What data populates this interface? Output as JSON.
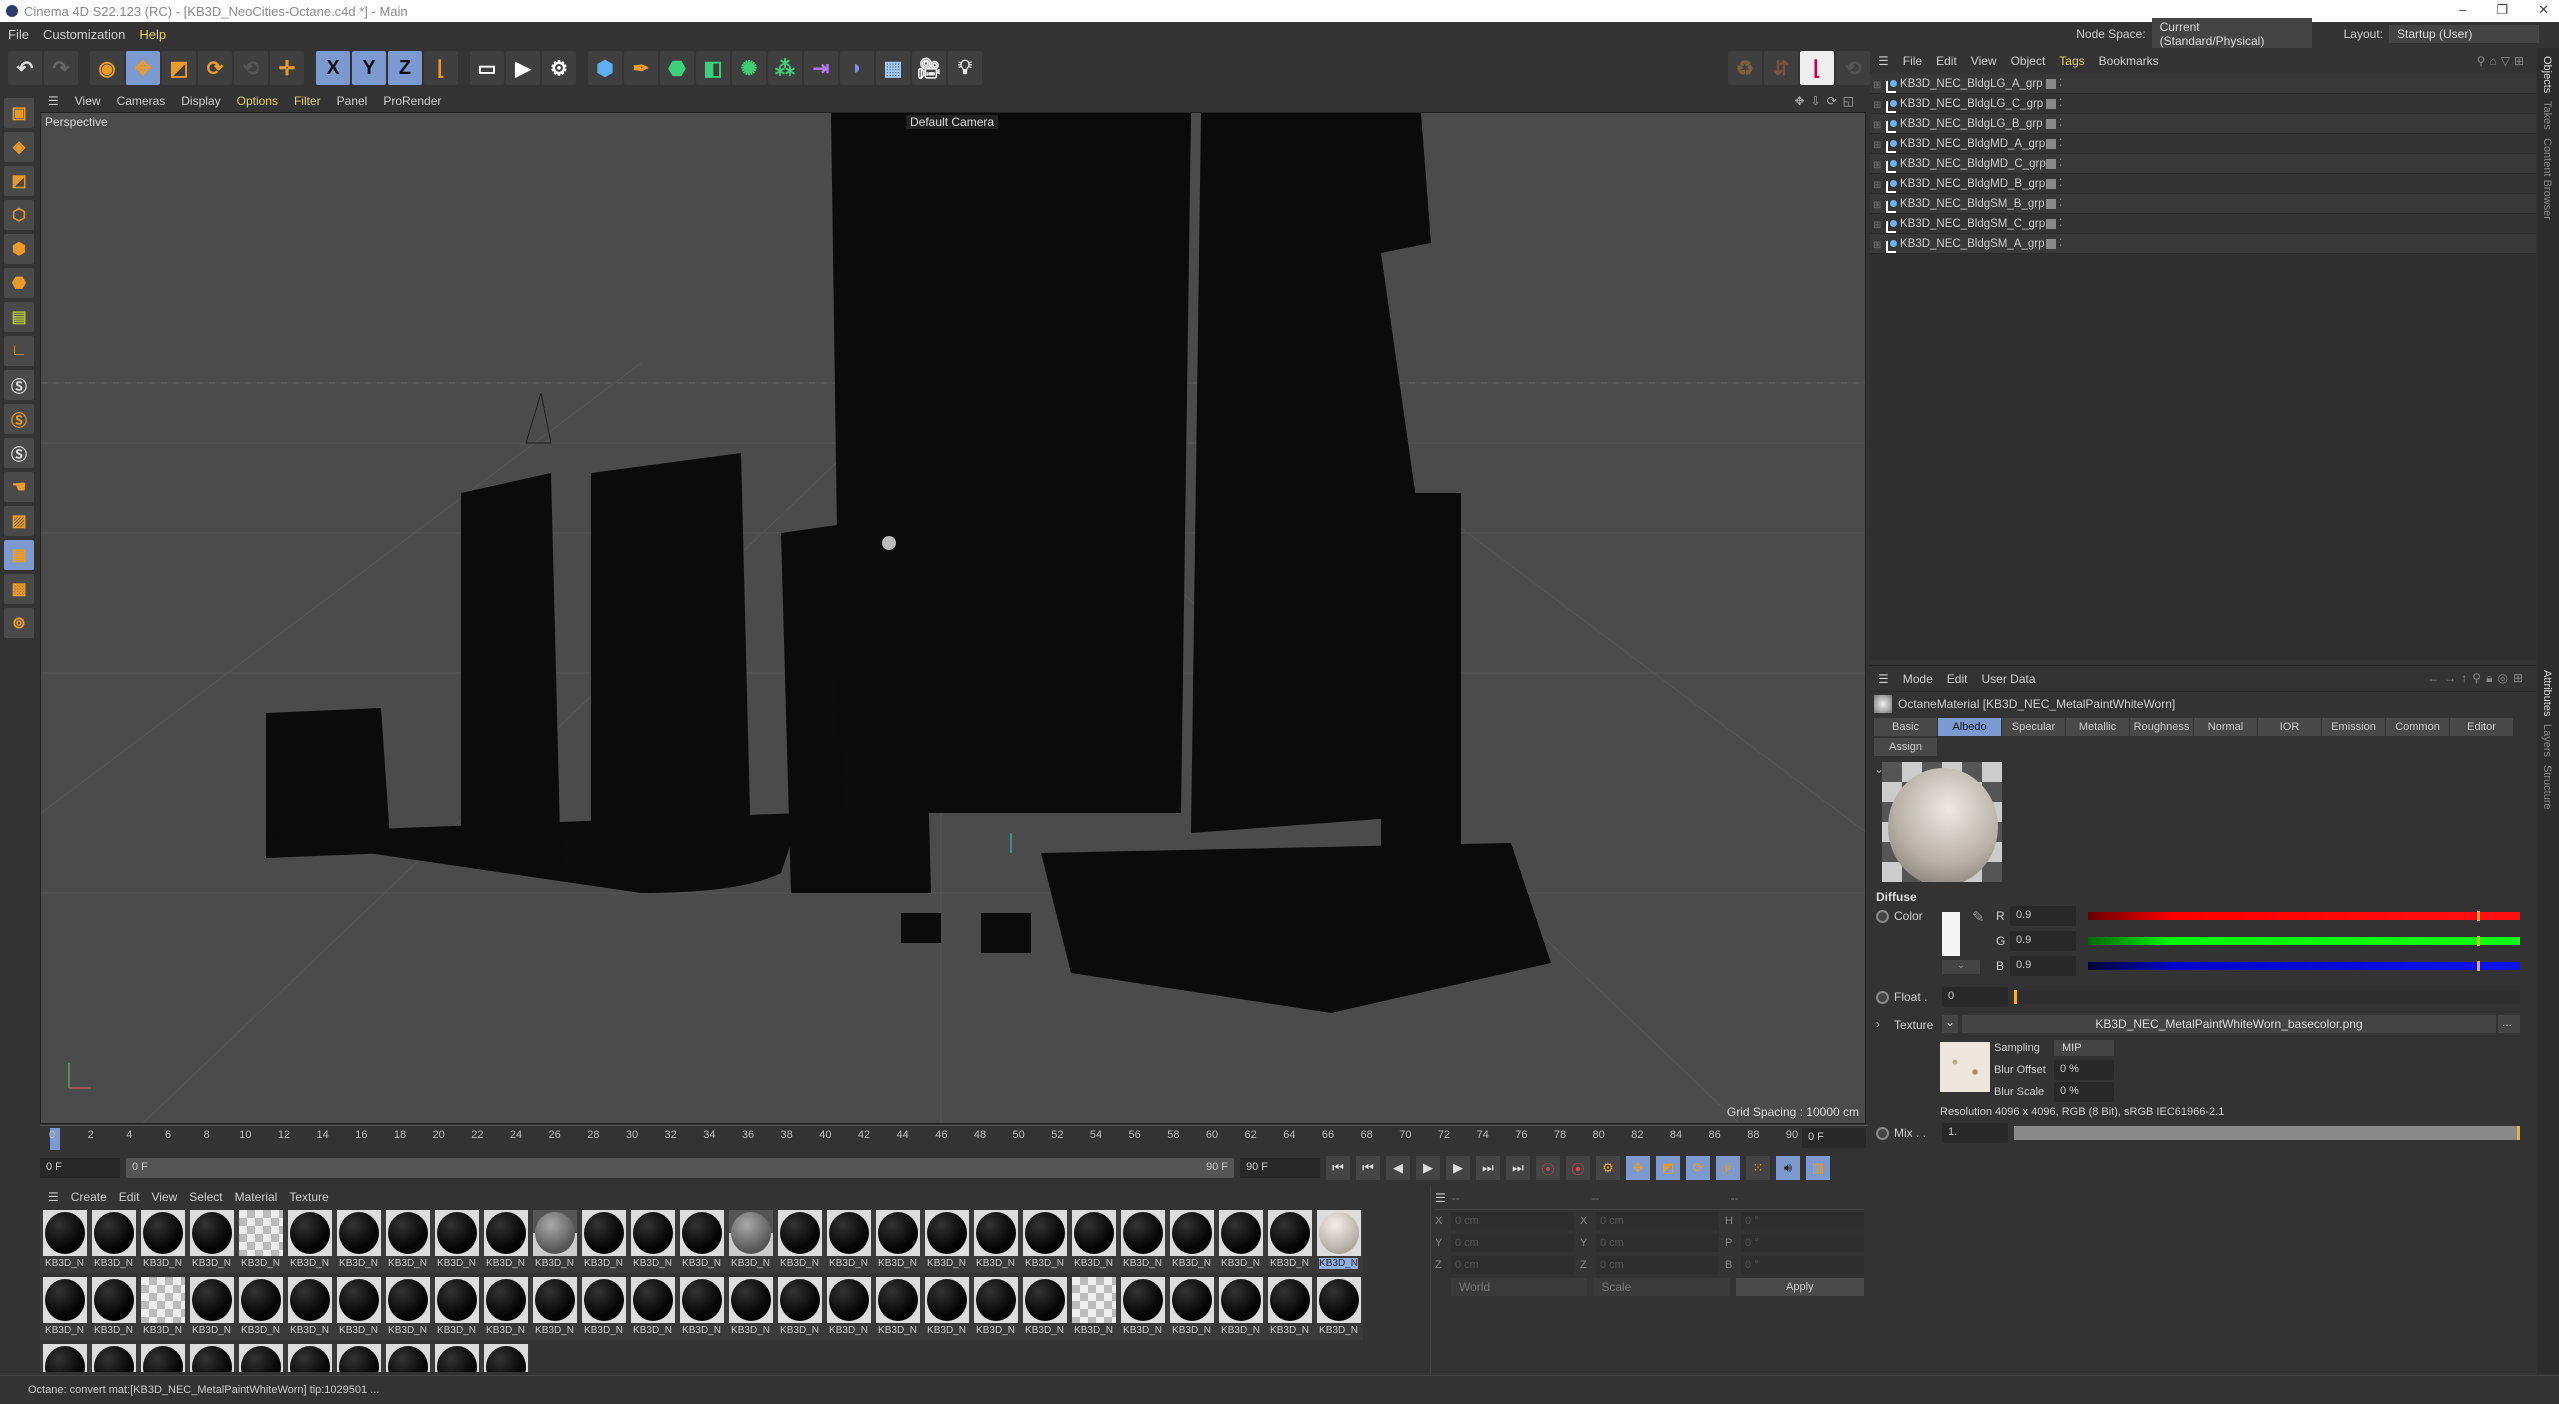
{
  "window": {
    "title": "Cinema 4D S22.123 (RC) - [KB3D_NeoCities-Octane.c4d *] - Main",
    "controls": [
      "–",
      "❐",
      "✕"
    ]
  },
  "menu": [
    {
      "label": "File"
    },
    {
      "label": "Customization"
    },
    {
      "label": "Help",
      "highlight": true
    }
  ],
  "toolbar": {
    "icons": [
      "undo-icon",
      "redo-icon",
      "select-icon",
      "move-icon",
      "scale-icon",
      "rotate-icon",
      "psr-icon",
      "world-axis-icon",
      "x-axis-icon",
      "y-axis-icon",
      "z-axis-icon",
      "coordinate-system-icon",
      "render-view-icon",
      "render-picture-viewer-icon",
      "render-settings-icon",
      "cube-icon",
      "pen-icon",
      "subdivision-icon",
      "extrude-icon",
      "cloner-icon",
      "mograph-icon",
      "deformer-icon",
      "bend-icon",
      "floor-icon",
      "camera-icon",
      "light-icon"
    ],
    "xyz": [
      "X",
      "Y",
      "Z"
    ]
  },
  "viewport": {
    "menu": [
      {
        "label": "View"
      },
      {
        "label": "Cameras"
      },
      {
        "label": "Display"
      },
      {
        "label": "Options",
        "highlight": true
      },
      {
        "label": "Filter",
        "highlight": true
      },
      {
        "label": "Panel"
      },
      {
        "label": "ProRender"
      }
    ],
    "projection": "Perspective",
    "camera": "Default Camera",
    "grid_spacing": "Grid Spacing : 10000 cm"
  },
  "timeline": {
    "min": 0,
    "max": 90,
    "step": 2,
    "current": "0 F",
    "start": "0 F",
    "range_start": "0 F",
    "range_end": "90 F",
    "end": "90 F",
    "current_right": "0 F"
  },
  "materials": {
    "menu": [
      "Create",
      "Edit",
      "View",
      "Select",
      "Material",
      "Texture"
    ],
    "label": "KB3D_N",
    "row1": [
      "black",
      "black",
      "black",
      "black",
      "checker",
      "black",
      "black",
      "black",
      "black",
      "black",
      "env",
      "black",
      "black",
      "black",
      "env",
      "black",
      "black",
      "black",
      "black",
      "black",
      "black",
      "black",
      "black",
      "black",
      "black",
      "black",
      "white"
    ],
    "row2": [
      "black",
      "black",
      "checker",
      "black",
      "black",
      "black",
      "black",
      "black",
      "black",
      "black",
      "black",
      "black",
      "black",
      "black",
      "black",
      "black",
      "black",
      "black",
      "black",
      "black",
      "black",
      "checker",
      "black",
      "black",
      "black",
      "black",
      "black"
    ],
    "row3": [
      "black",
      "black",
      "black",
      "black",
      "black",
      "black",
      "black",
      "black",
      "black",
      "black"
    ],
    "selected_index": 26
  },
  "coords": {
    "headers": [
      "--",
      "--",
      "--"
    ],
    "rows": [
      [
        "X",
        "0 cm",
        "X",
        "0 cm",
        "H",
        "0 °"
      ],
      [
        "Y",
        "0 cm",
        "Y",
        "0 cm",
        "P",
        "0 °"
      ],
      [
        "Z",
        "0 cm",
        "Z",
        "0 cm",
        "B",
        "0 °"
      ]
    ],
    "mode": "World",
    "scale": "Scale",
    "apply": "Apply"
  },
  "status": "Octane:  convert mat:[KB3D_NEC_MetalPaintWhiteWorn]  tip:1029501   ...",
  "nodebar": {
    "node_space_label": "Node Space:",
    "node_space": "Current (Standard/Physical)",
    "layout_label": "Layout:",
    "layout": "Startup (User)"
  },
  "objects": {
    "menu": [
      {
        "label": "File"
      },
      {
        "label": "Edit"
      },
      {
        "label": "View"
      },
      {
        "label": "Object"
      },
      {
        "label": "Tags",
        "highlight": true
      },
      {
        "label": "Bookmarks"
      }
    ],
    "items": [
      "KB3D_NEC_BldgLG_A_grp",
      "KB3D_NEC_BldgLG_C_grp",
      "KB3D_NEC_BldgLG_B_grp",
      "KB3D_NEC_BldgMD_A_grp",
      "KB3D_NEC_BldgMD_C_grp",
      "KB3D_NEC_BldgMD_B_grp",
      "KB3D_NEC_BldgSM_B_grp",
      "KB3D_NEC_BldgSM_C_grp",
      "KB3D_NEC_BldgSM_A_grp"
    ]
  },
  "side_tabs_top": [
    "Objects",
    "Takes",
    "Content Browser"
  ],
  "side_tabs_bottom": [
    "Attributes",
    "Layers",
    "Structure"
  ],
  "attributes": {
    "menu": [
      "Mode",
      "Edit",
      "User Data"
    ],
    "title": "OctaneMaterial [KB3D_NEC_MetalPaintWhiteWorn]",
    "tabs": [
      "Basic",
      "Albedo",
      "Specular",
      "Metallic",
      "Roughness",
      "Normal",
      "IOR",
      "Emission",
      "Common",
      "Editor",
      "Assign"
    ],
    "active_tab": "Albedo",
    "section": "Diffuse",
    "color_label": "Color",
    "r_label": "R",
    "g_label": "G",
    "b_label": "B",
    "r": "0.9",
    "g": "0.9",
    "b": "0.9",
    "rgb_fraction": 0.9,
    "float_label": "Float .",
    "float": "0",
    "texture_label": "Texture",
    "texture": "KB3D_NEC_MetalPaintWhiteWorn_basecolor.png",
    "browse": "...",
    "sampling_label": "Sampling",
    "sampling": "MIP",
    "blur_offset_label": "Blur Offset",
    "blur_offset": "0 %",
    "blur_scale_label": "Blur Scale",
    "blur_scale": "0 %",
    "resolution": "Resolution 4096 x 4096, RGB (8 Bit), sRGB IEC61966-2.1",
    "mix_label": "Mix . .",
    "mix": "1.",
    "mix_fraction": 1.0
  }
}
